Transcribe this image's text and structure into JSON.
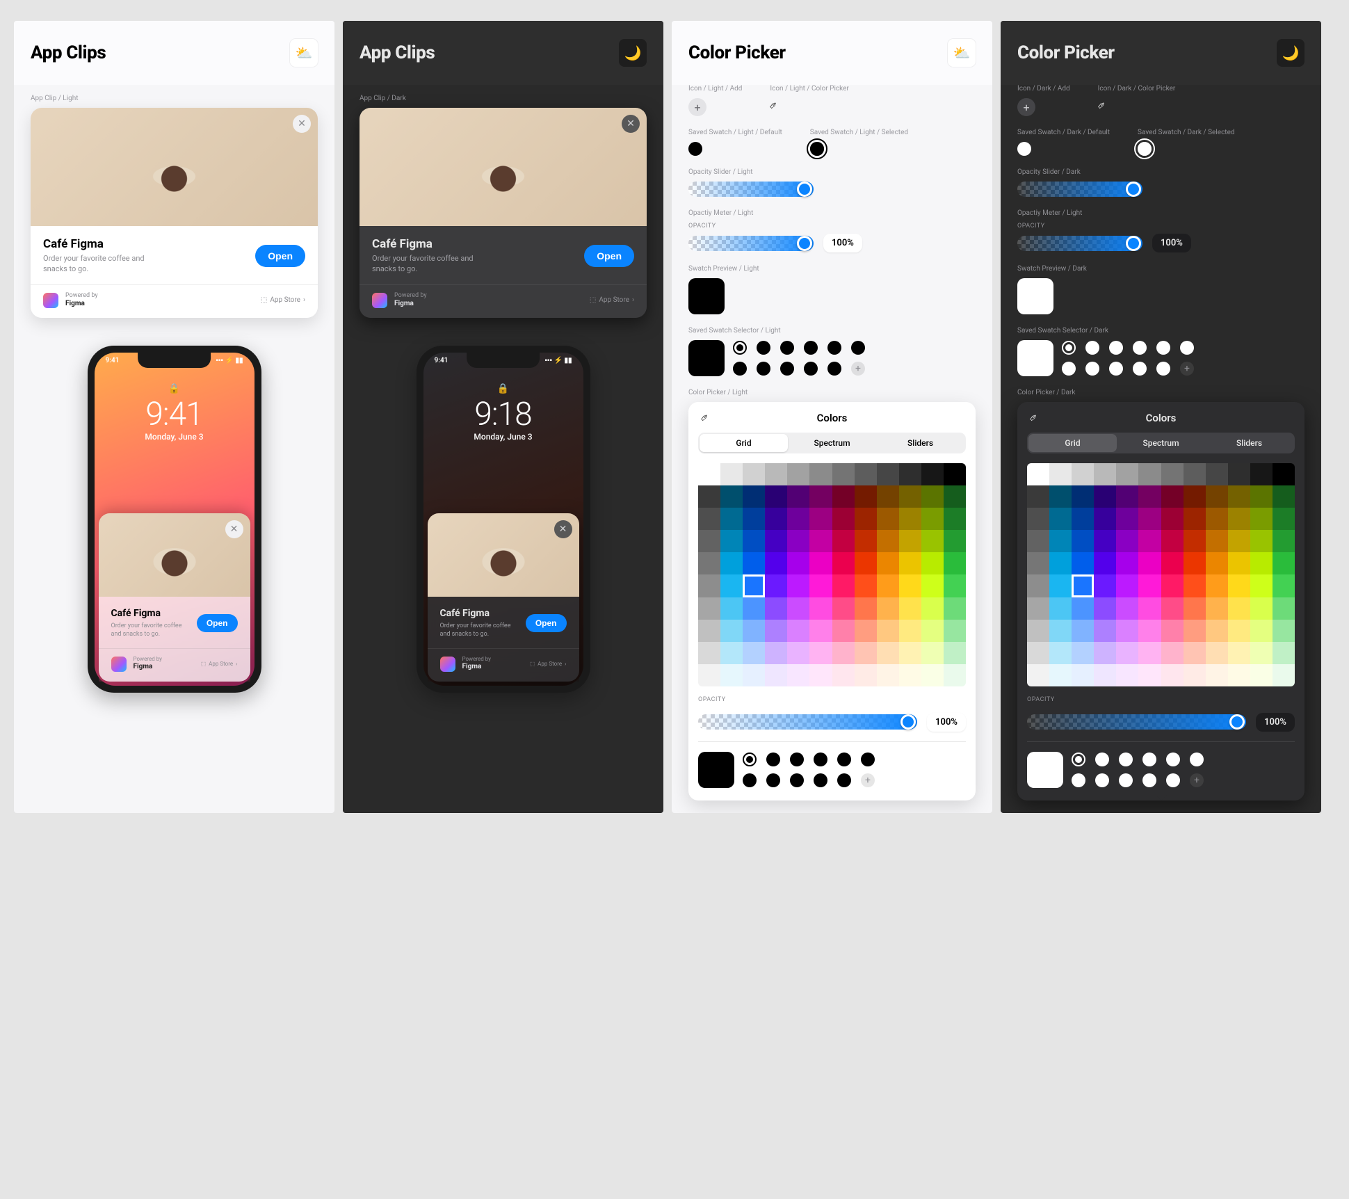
{
  "panels": {
    "app_clips_light": {
      "title": "App Clips",
      "theme_icon": "⛅"
    },
    "app_clips_dark": {
      "title": "App Clips",
      "theme_icon": "🌙"
    },
    "color_picker_light": {
      "title": "Color Picker",
      "theme_icon": "⛅"
    },
    "color_picker_dark": {
      "title": "Color Picker",
      "theme_icon": "🌙"
    }
  },
  "sections": {
    "app_clip_light": "App Clip / Light",
    "app_clip_dark": "App Clip / Dark",
    "icon_light_add": "Icon / Light / Add",
    "icon_light_picker": "Icon / Light / Color Picker",
    "icon_dark_add": "Icon / Dark / Add",
    "icon_dark_picker": "Icon / Dark / Color Picker",
    "saved_swatch_light_default": "Saved Swatch / Light / Default",
    "saved_swatch_light_selected": "Saved Swatch / Light / Selected",
    "saved_swatch_dark_default": "Saved Swatch / Dark / Default",
    "saved_swatch_dark_selected": "Saved Swatch / Dark / Selected",
    "opacity_slider_light": "Opacity Slider / Light",
    "opacity_slider_dark": "Opacity Slider / Dark",
    "opacity_meter_light": "Opactiy Meter / Light",
    "opacity_meter_dark": "Opactiy Meter / Light",
    "swatch_preview_light": "Swatch Preview / Light",
    "swatch_preview_dark": "Swatch Preview / Dark",
    "saved_selector_light": "Saved Swatch Selector / Light",
    "saved_selector_dark": "Saved Swatch Selector / Dark",
    "color_picker_light": "Color Picker / Light",
    "color_picker_dark": "Color Picker / Dark"
  },
  "clip": {
    "title": "Café Figma",
    "subtitle": "Order your favorite coffee and snacks to go.",
    "open": "Open",
    "powered_label": "Powered by",
    "powered_by": "Figma",
    "store": "App Store"
  },
  "status": {
    "time_light": "9:41",
    "time_dark": "9:18",
    "date": "Monday, June 3",
    "carrier_glyphs": "▪▪▪ ⚡ ▮▮"
  },
  "picker": {
    "title": "Colors",
    "tabs": [
      "Grid",
      "Spectrum",
      "Sliders"
    ],
    "active_tab": "Grid",
    "opacity_label": "OPACITY",
    "opacity_value": "100%"
  },
  "color_grid": {
    "hues": [
      "#808080",
      "#00aeef",
      "#0066ff",
      "#5a00ff",
      "#b400ff",
      "#ff00d4",
      "#ff0055",
      "#ff3b00",
      "#ff9100",
      "#ffd500",
      "#c8ff00",
      "#2ecc40"
    ],
    "rows": 10,
    "selected": {
      "row": 5,
      "col": 2
    }
  }
}
